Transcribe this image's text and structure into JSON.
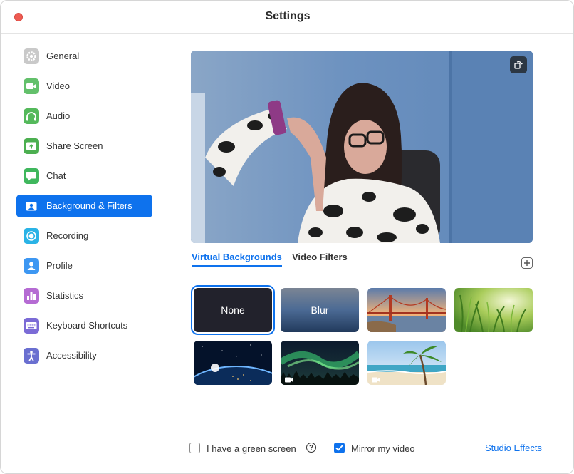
{
  "window": {
    "title": "Settings"
  },
  "sidebar": {
    "items": [
      {
        "label": "General",
        "icon": "gear-icon",
        "color": "#c9c9c9"
      },
      {
        "label": "Video",
        "icon": "video-camera-icon",
        "color": "#63c06b"
      },
      {
        "label": "Audio",
        "icon": "headphones-icon",
        "color": "#54b95b"
      },
      {
        "label": "Share Screen",
        "icon": "share-screen-icon",
        "color": "#4caf50"
      },
      {
        "label": "Chat",
        "icon": "chat-bubble-icon",
        "color": "#3fb75d"
      },
      {
        "label": "Background & Filters",
        "icon": "person-background-icon",
        "color": "#0e72ed",
        "active": true
      },
      {
        "label": "Recording",
        "icon": "record-icon",
        "color": "#2ab3e6"
      },
      {
        "label": "Profile",
        "icon": "profile-icon",
        "color": "#3d97f2"
      },
      {
        "label": "Statistics",
        "icon": "bar-chart-icon",
        "color": "#b56bd3"
      },
      {
        "label": "Keyboard Shortcuts",
        "icon": "keyboard-icon",
        "color": "#7b6bd6"
      },
      {
        "label": "Accessibility",
        "icon": "accessibility-icon",
        "color": "#6a6fd0"
      }
    ]
  },
  "tabs": {
    "active": "Virtual Backgrounds",
    "inactive": "Video Filters"
  },
  "backgrounds": [
    {
      "label": "None",
      "selected": true
    },
    {
      "label": "Blur"
    },
    {
      "label": ""
    },
    {
      "label": ""
    },
    {
      "label": ""
    },
    {
      "label": ""
    },
    {
      "label": ""
    }
  ],
  "footer": {
    "green_screen_label": "I have a green screen",
    "green_screen_checked": false,
    "mirror_label": "Mirror my video",
    "mirror_checked": true,
    "studio_effects_label": "Studio Effects"
  },
  "colors": {
    "accent": "#0e72ed",
    "close": "#ee5b52"
  }
}
